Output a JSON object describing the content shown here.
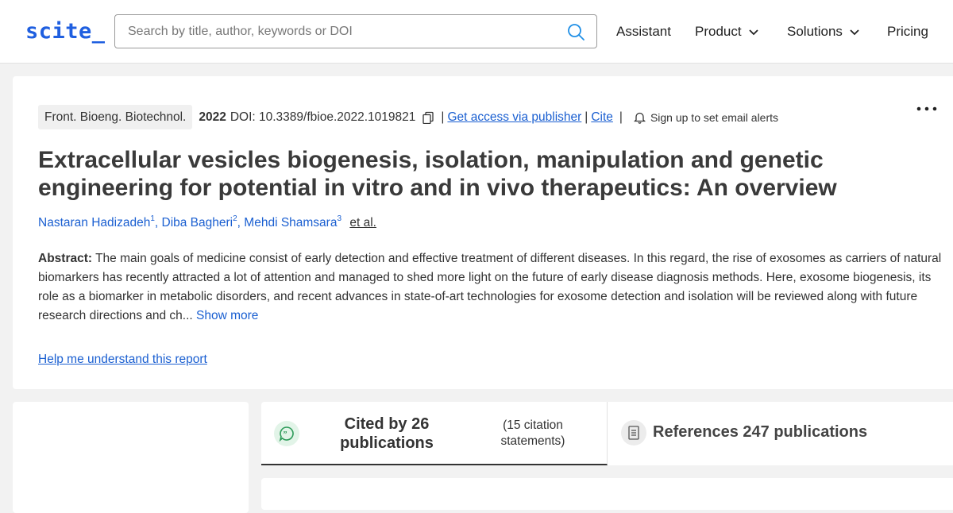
{
  "header": {
    "logo": "scite_",
    "search_placeholder": "Search by title, author, keywords or DOI",
    "nav": {
      "assistant": "Assistant",
      "product": "Product",
      "solutions": "Solutions",
      "pricing": "Pricing"
    }
  },
  "article": {
    "journal": "Front. Bioeng. Biotechnol.",
    "year": "2022",
    "doi": "DOI: 10.3389/fbioe.2022.1019821",
    "access_link": "Get access via publisher",
    "cite_link": "Cite",
    "alerts_label": "Sign up to set email alerts",
    "title": "Extracellular vesicles biogenesis, isolation, manipulation and genetic engineering for potential in vitro and in vivo therapeutics: An overview",
    "authors": [
      {
        "name": "Nastaran Hadizadeh",
        "sup": "1"
      },
      {
        "name": "Diba Bagheri",
        "sup": "2"
      },
      {
        "name": "Mehdi Shamsara",
        "sup": "3"
      }
    ],
    "et_al": "et al.",
    "abstract_label": "Abstract:",
    "abstract_text": "The main goals of medicine consist of early detection and effective treatment of different diseases. In this regard, the rise of exosomes as carriers of natural biomarkers has recently attracted a lot of attention and managed to shed more light on the future of early disease diagnosis methods. Here, exosome biogenesis, its role as a biomarker in metabolic disorders, and recent advances in state-of-art technologies for exosome detection and isolation will be reviewed along with future research directions and ch...",
    "show_more": "Show more",
    "help_link": "Help me understand this report"
  },
  "tabs": {
    "cited_label": "Cited by 26 publications",
    "cited_sub": "(15 citation statements)",
    "references_label": "References 247 publications"
  },
  "colors": {
    "brand": "#1f5fe0",
    "link": "#1a5fd1",
    "cited_badge_bg": "#e2f4e8",
    "cited_badge_icon": "#2e9b5a"
  }
}
